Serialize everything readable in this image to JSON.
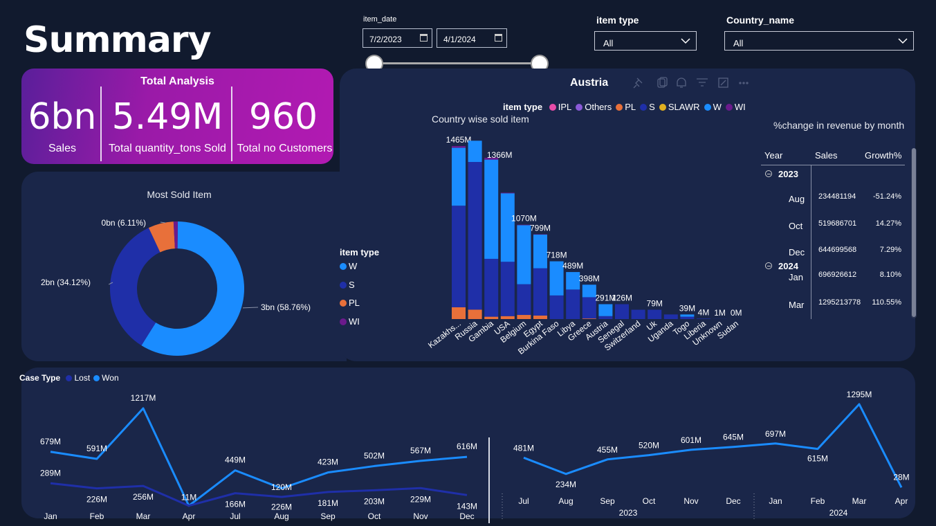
{
  "page_title": "Summary",
  "slicers": {
    "date_label": "item_date",
    "date_from": "7/2/2023",
    "date_to": "4/1/2024",
    "item_type_label": "item type",
    "item_type_value": "All",
    "country_label": "Country_name",
    "country_value": "All"
  },
  "kpi": {
    "title": "Total Analysis",
    "cards": [
      {
        "value": "6bn",
        "label": "Sales"
      },
      {
        "value": "5.49M",
        "label": "Total quantity_tons Sold"
      },
      {
        "value": "960",
        "label": "Total no Customers"
      }
    ]
  },
  "donut": {
    "title": "Most Sold Item",
    "legend_title": "item type",
    "legend": [
      {
        "name": "W",
        "color": "#1a8cff"
      },
      {
        "name": "S",
        "color": "#1f2fa8"
      },
      {
        "name": "PL",
        "color": "#e8703a"
      },
      {
        "name": "WI",
        "color": "#6b1a8c"
      }
    ],
    "slices": [
      {
        "name": "W",
        "value": 58.76,
        "color": "#1a8cff",
        "label": "3bn (58.76%)"
      },
      {
        "name": "S",
        "value": 34.12,
        "color": "#1f2fa8",
        "label": "2bn (34.12%)"
      },
      {
        "name": "PL",
        "value": 6.11,
        "color": "#e8703a",
        "label": "0bn (6.11%)"
      },
      {
        "name": "WI",
        "value": 1.01,
        "color": "#6b1a8c",
        "label": ""
      }
    ]
  },
  "bar_visual": {
    "header": "Austria",
    "title": "Country wise sold item",
    "legend_title": "item type",
    "legend": [
      {
        "name": "IPL",
        "color": "#e84ca8"
      },
      {
        "name": "Others",
        "color": "#8a5ad8"
      },
      {
        "name": "PL",
        "color": "#e8703a"
      },
      {
        "name": "S",
        "color": "#1f2fa8"
      },
      {
        "name": "SLAWR",
        "color": "#e0b020"
      },
      {
        "name": "W",
        "color": "#1a8cff"
      },
      {
        "name": "WI",
        "color": "#6b1a8c"
      }
    ]
  },
  "table": {
    "title": "%change in revenue by month",
    "headers": [
      "Year",
      "Sales",
      "Growth%"
    ],
    "groups": [
      {
        "year": "2023",
        "rows": [
          {
            "month": "Aug",
            "sales": "234481194",
            "growth": "-51.24%"
          },
          {
            "month": "Oct",
            "sales": "519686701",
            "growth": "14.27%"
          },
          {
            "month": "Dec",
            "sales": "644699568",
            "growth": "7.29%"
          }
        ]
      },
      {
        "year": "2024",
        "rows": [
          {
            "month": "Jan",
            "sales": "696926612",
            "growth": "8.10%"
          },
          {
            "month": "Mar",
            "sales": "1295213778",
            "growth": "110.55%"
          }
        ]
      }
    ]
  },
  "line_visual": {
    "legend_title": "Case Type",
    "legend": [
      {
        "name": "Lost",
        "color": "#1f2fa8"
      },
      {
        "name": "Won",
        "color": "#1a8cff"
      }
    ],
    "years": [
      "2023",
      "2024"
    ]
  },
  "chart_data": [
    {
      "type": "pie",
      "title": "Most Sold Item",
      "categories": [
        "W",
        "S",
        "PL",
        "WI"
      ],
      "values": [
        58.76,
        34.12,
        6.11,
        1.01
      ],
      "data_labels": [
        "3bn (58.76%)",
        "2bn (34.12%)",
        "0bn (6.11%)",
        ""
      ]
    },
    {
      "type": "bar",
      "stacked": true,
      "title": "Country wise sold item",
      "categories": [
        "Kazakhs...",
        "Russia",
        "Gambia",
        "USA",
        "Belgium",
        "Egypt",
        "Burkina Faso",
        "Libya",
        "Greece",
        "Austria",
        "Senegal",
        "Switzerland",
        "Uk",
        "Uganda",
        "Togo",
        "Liberia",
        "Unknown",
        "Sudan"
      ],
      "totals": [
        1465,
        1366,
        1366,
        1070,
        799,
        718,
        489,
        398,
        291,
        126,
        126,
        79,
        79,
        39,
        39,
        4,
        1,
        0
      ],
      "data_labels": [
        "1465M",
        "",
        "1366M",
        "",
        "1070M",
        "799M",
        "718M",
        "489M",
        "398M",
        "291M",
        "126M",
        "",
        "79M",
        "",
        "39M",
        "4M",
        "1M",
        "0M"
      ],
      "series": [
        {
          "name": "PL",
          "values": [
            100,
            80,
            20,
            25,
            35,
            30,
            0,
            0,
            5,
            0,
            0,
            0,
            0,
            0,
            0,
            0,
            0,
            0
          ]
        },
        {
          "name": "S",
          "values": [
            860,
            1250,
            490,
            460,
            260,
            400,
            200,
            250,
            180,
            25,
            126,
            79,
            79,
            39,
            20,
            4,
            1,
            0
          ]
        },
        {
          "name": "W",
          "values": [
            490,
            180,
            840,
            580,
            500,
            285,
            289,
            148,
            106,
            101,
            0,
            0,
            0,
            0,
            19,
            0,
            0,
            0
          ]
        },
        {
          "name": "WI",
          "values": [
            15,
            0,
            16,
            5,
            4,
            3,
            0,
            0,
            0,
            0,
            0,
            0,
            0,
            0,
            0,
            0,
            0,
            0
          ]
        }
      ]
    },
    {
      "type": "line",
      "categories": [
        "Jan",
        "Feb",
        "Mar",
        "Apr",
        "Jul",
        "Aug",
        "Sep",
        "Oct",
        "Nov",
        "Dec"
      ],
      "series": [
        {
          "name": "Won",
          "values": [
            679,
            591,
            1217,
            11,
            449,
            226,
            423,
            502,
            567,
            616
          ],
          "labels": [
            "679M",
            "591M",
            "1217M",
            "11M",
            "449M",
            "226M",
            "423M",
            "502M",
            "567M",
            "616M"
          ]
        },
        {
          "name": "Lost",
          "values": [
            289,
            226,
            256,
            11,
            166,
            120,
            181,
            203,
            229,
            143
          ],
          "labels": [
            "289M",
            "226M",
            "256M",
            "",
            "166M",
            "120M",
            "181M",
            "203M",
            "229M",
            "143M"
          ]
        }
      ]
    },
    {
      "type": "line",
      "categories": [
        "Jul",
        "Aug",
        "Sep",
        "Oct",
        "Nov",
        "Dec",
        "Jan",
        "Feb",
        "Mar",
        "Apr"
      ],
      "year_groups": [
        {
          "year": "2023",
          "months": [
            "Jul",
            "Aug",
            "Sep",
            "Oct",
            "Nov",
            "Dec"
          ]
        },
        {
          "year": "2024",
          "months": [
            "Jan",
            "Feb",
            "Mar",
            "Apr"
          ]
        }
      ],
      "series": [
        {
          "name": "Sales",
          "values": [
            481,
            234,
            455,
            520,
            601,
            645,
            697,
            615,
            1295,
            28
          ],
          "labels": [
            "481M",
            "234M",
            "455M",
            "520M",
            "601M",
            "645M",
            "697M",
            "615M",
            "1295M",
            "28M"
          ]
        }
      ]
    }
  ]
}
